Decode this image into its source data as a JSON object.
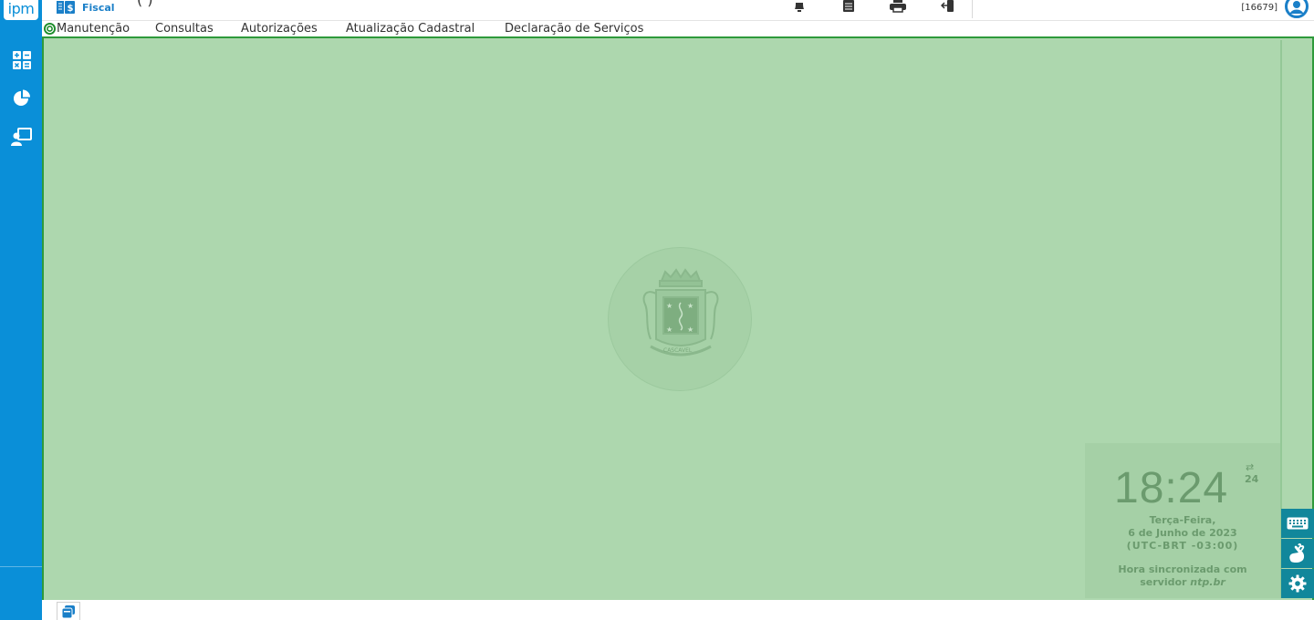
{
  "sidebar": {
    "logo_text": "ipm",
    "items": [
      {
        "icon": "calculator-icon"
      },
      {
        "icon": "pie-chart-icon"
      },
      {
        "icon": "user-screen-icon"
      }
    ]
  },
  "topbar": {
    "title_fragment": "(                )",
    "app_label": "Fiscal",
    "app_icon": "document-dollar-icon",
    "icons": [
      "bell-icon",
      "list-icon",
      "printer-icon",
      "mobile-transfer-icon"
    ],
    "user_code": "[16679]",
    "user_icon": "user-circle-icon"
  },
  "menu": {
    "items": [
      "Manutenção",
      "Consultas",
      "Autorizações",
      "Atualização Cadastral",
      "Declaração de Serviços"
    ]
  },
  "crest": {
    "label": "CASCAVEL"
  },
  "clock": {
    "time": "18:24",
    "swap_symbol": "⇄",
    "format_label": "24",
    "weekday": "Terça-Feira,",
    "date": "6 de Junho de 2023",
    "timezone": "(UTC-BRT -03:00)",
    "sync_line1": "Hora sincronizada com",
    "sync_line2_prefix": "servidor ",
    "sync_server": "ntp.br"
  },
  "right_tools": [
    "keyboard-icon",
    "sign-language-icon",
    "settings-icon"
  ],
  "colors": {
    "sidebar": "#0a8fd8",
    "workspace": "#add7ae",
    "workspace_border": "#2e9a3b",
    "tool_buttons": "#11879b"
  }
}
